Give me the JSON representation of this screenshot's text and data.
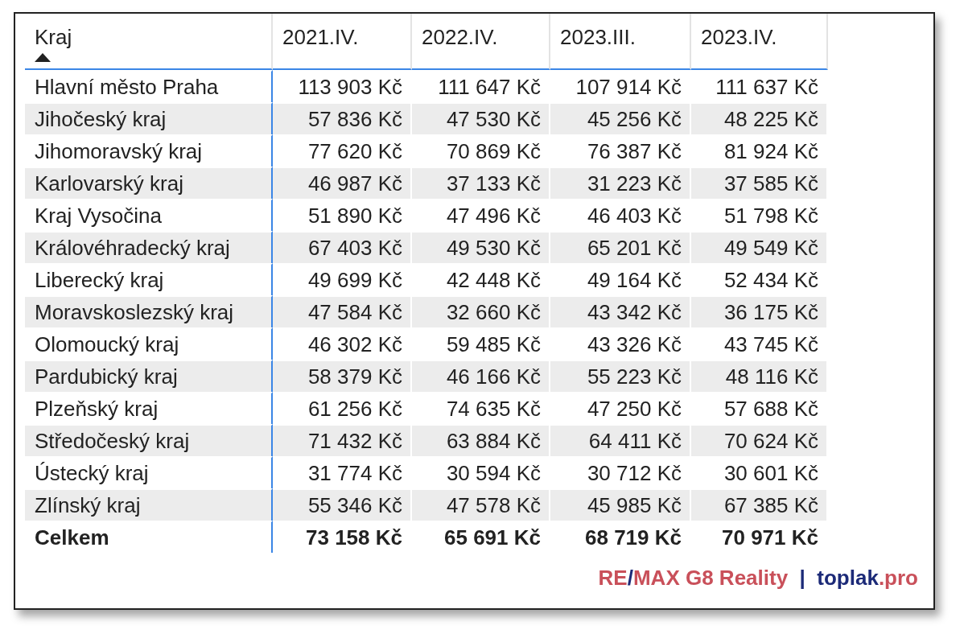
{
  "table": {
    "columns": [
      {
        "label": "Kraj",
        "sorted": true
      },
      {
        "label": "2021.IV.",
        "sorted": false
      },
      {
        "label": "2022.IV.",
        "sorted": false
      },
      {
        "label": "2023.III.",
        "sorted": false
      },
      {
        "label": "2023.IV.",
        "sorted": false
      }
    ],
    "rows": [
      [
        "Hlavní město Praha",
        "113 903 Kč",
        "111 647 Kč",
        "107 914 Kč",
        "111 637 Kč"
      ],
      [
        "Jihočeský kraj",
        "57 836 Kč",
        "47 530 Kč",
        "45 256 Kč",
        "48 225 Kč"
      ],
      [
        "Jihomoravský kraj",
        "77 620 Kč",
        "70 869 Kč",
        "76 387 Kč",
        "81 924 Kč"
      ],
      [
        "Karlovarský kraj",
        "46 987 Kč",
        "37 133 Kč",
        "31 223 Kč",
        "37 585 Kč"
      ],
      [
        "Kraj Vysočina",
        "51 890 Kč",
        "47 496 Kč",
        "46 403 Kč",
        "51 798 Kč"
      ],
      [
        "Královéhradecký kraj",
        "67 403 Kč",
        "49 530 Kč",
        "65 201 Kč",
        "49 549 Kč"
      ],
      [
        "Liberecký kraj",
        "49 699 Kč",
        "42 448 Kč",
        "49 164 Kč",
        "52 434 Kč"
      ],
      [
        "Moravskoslezský kraj",
        "47 584 Kč",
        "32 660 Kč",
        "43 342 Kč",
        "36 175 Kč"
      ],
      [
        "Olomoucký kraj",
        "46 302 Kč",
        "59 485 Kč",
        "43 326 Kč",
        "43 745 Kč"
      ],
      [
        "Pardubický kraj",
        "58 379 Kč",
        "46 166 Kč",
        "55 223 Kč",
        "48 116 Kč"
      ],
      [
        "Plzeňský kraj",
        "61 256 Kč",
        "74 635 Kč",
        "47 250 Kč",
        "57 688 Kč"
      ],
      [
        "Středočeský kraj",
        "71 432 Kč",
        "63 884 Kč",
        "64 411 Kč",
        "70 624 Kč"
      ],
      [
        "Ústecký kraj",
        "31 774 Kč",
        "30 594 Kč",
        "30 712 Kč",
        "30 601 Kč"
      ],
      [
        "Zlínský kraj",
        "55 346 Kč",
        "47 578 Kč",
        "45 985 Kč",
        "67 385 Kč"
      ]
    ],
    "total": [
      "Celkem",
      "73 158 Kč",
      "65 691 Kč",
      "68 719 Kč",
      "70 971 Kč"
    ]
  },
  "footer": {
    "segments": [
      {
        "text": "RE",
        "color": "#c9505a"
      },
      {
        "text": "/",
        "color": "#1c2a78"
      },
      {
        "text": "MAX G8 Reality",
        "color": "#c9505a"
      },
      {
        "text": "|",
        "color": "#1c2a78"
      },
      {
        "text": "toplak",
        "color": "#1c2a78"
      },
      {
        "text": ".pro",
        "color": "#c9505a"
      }
    ]
  }
}
